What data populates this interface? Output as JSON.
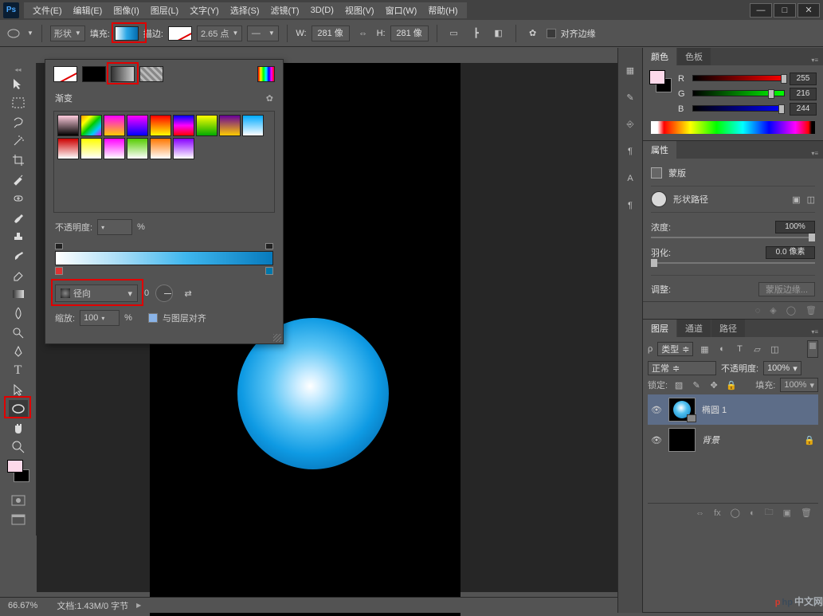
{
  "menu": {
    "file": "文件(E)",
    "edit": "编辑(E)",
    "image": "图像(I)",
    "layer": "图层(L)",
    "type": "文字(Y)",
    "select": "选择(S)",
    "filter": "滤镜(T)",
    "threeD": "3D(D)",
    "view": "视图(V)",
    "window": "窗口(W)",
    "help": "帮助(H)"
  },
  "options": {
    "shape_mode": "形状",
    "fill_label": "填充:",
    "stroke_label": "描边:",
    "stroke_width": "2.65 点",
    "w_label": "W:",
    "w_value": "281 像",
    "h_label": "H:",
    "h_value": "281 像",
    "align_edges": "对齐边缘"
  },
  "flyout": {
    "title": "渐变",
    "opacity_label": "不透明度:",
    "opacity_unit": "%",
    "type_value": "径向",
    "type_deg": "0",
    "scale_label": "缩放:",
    "scale_value": "100",
    "scale_unit": "%",
    "align_layer": "与图层对齐"
  },
  "panels": {
    "color_tab": "颜色",
    "swatches_tab": "色板",
    "r": "R",
    "r_val": "255",
    "g": "G",
    "g_val": "216",
    "b": "B",
    "b_val": "244",
    "props_tab": "属性",
    "mask_title": "蒙版",
    "shape_path": "形状路径",
    "density": "浓度:",
    "density_val": "100%",
    "feather": "羽化:",
    "feather_val": "0.0 像素",
    "adjust": "调整:",
    "mask_edge": "蒙版边缘...",
    "layers_tab": "图层",
    "channels_tab": "通道",
    "paths_tab": "路径",
    "kind_label": "类型",
    "blend_mode": "正常",
    "opacity_label": "不透明度:",
    "opacity_val": "100%",
    "lock_label": "锁定:",
    "fill_label": "填充:",
    "fill_val": "100%",
    "layer1": "椭圆 1",
    "layer_bg": "背景"
  },
  "status": {
    "zoom": "66.67%",
    "doc": "文档:1.43M/0 字节"
  },
  "watermark": {
    "cn": "中文网"
  }
}
